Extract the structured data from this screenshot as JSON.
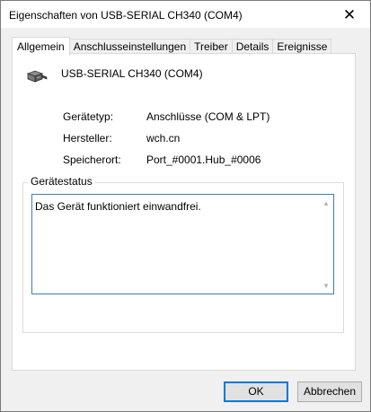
{
  "window": {
    "title": "Eigenschaften von USB-SERIAL CH340 (COM4)",
    "close_glyph": "✕"
  },
  "tabs": [
    {
      "label": "Allgemein",
      "active": true
    },
    {
      "label": "Anschlusseinstellungen",
      "active": false
    },
    {
      "label": "Treiber",
      "active": false
    },
    {
      "label": "Details",
      "active": false
    },
    {
      "label": "Ereignisse",
      "active": false
    }
  ],
  "device": {
    "icon": "serial-port-icon",
    "name": "USB-SERIAL CH340 (COM4)"
  },
  "properties": [
    {
      "label": "Gerätetyp:",
      "value": "Anschlüsse (COM & LPT)"
    },
    {
      "label": "Hersteller:",
      "value": "wch.cn"
    },
    {
      "label": "Speicherort:",
      "value": "Port_#0001.Hub_#0006"
    }
  ],
  "status_group": {
    "label": "Gerätestatus",
    "text": "Das Gerät funktioniert einwandfrei."
  },
  "buttons": {
    "ok": "OK",
    "cancel": "Abbrechen"
  },
  "colors": {
    "focus_border": "#3c7fb1",
    "default_button_border": "#0078d7"
  }
}
